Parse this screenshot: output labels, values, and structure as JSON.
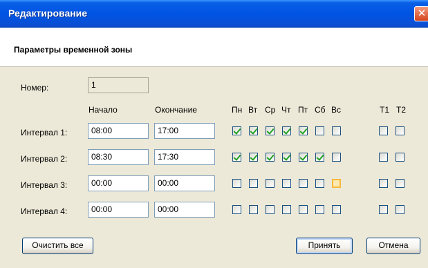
{
  "window": {
    "title": "Редактирование",
    "close_glyph": "✕"
  },
  "header": {
    "title": "Параметры временной зоны"
  },
  "number": {
    "label": "Номер:",
    "value": "1"
  },
  "columns": {
    "start": "Начало",
    "end": "Окончание"
  },
  "days": [
    "Пн",
    "Вт",
    "Ср",
    "Чт",
    "Пт",
    "Сб",
    "Вс"
  ],
  "extras": [
    "T1",
    "T2"
  ],
  "intervals": [
    {
      "label": "Интервал 1:",
      "start": "08:00",
      "end": "17:00",
      "days": [
        true,
        true,
        true,
        true,
        true,
        false,
        false
      ],
      "extras": [
        false,
        false
      ]
    },
    {
      "label": "Интервал 2:",
      "start": "08:30",
      "end": "17:30",
      "days": [
        true,
        true,
        true,
        true,
        true,
        true,
        false
      ],
      "extras": [
        false,
        false
      ]
    },
    {
      "label": "Интервал 3:",
      "start": "00:00",
      "end": "00:00",
      "days": [
        false,
        false,
        false,
        false,
        false,
        false,
        false
      ],
      "extras": [
        false,
        false
      ]
    },
    {
      "label": "Интервал 4:",
      "start": "00:00",
      "end": "00:00",
      "days": [
        false,
        false,
        false,
        false,
        false,
        false,
        false
      ],
      "extras": [
        false,
        false
      ]
    }
  ],
  "buttons": {
    "clear": "Очистить все",
    "accept": "Принять",
    "cancel": "Отмена"
  },
  "colors": {
    "titlebar": "#0054e3",
    "check": "#21a121",
    "focus": "#f7b93b"
  },
  "icons": {
    "close": "close-icon",
    "check": "checkmark-icon"
  }
}
